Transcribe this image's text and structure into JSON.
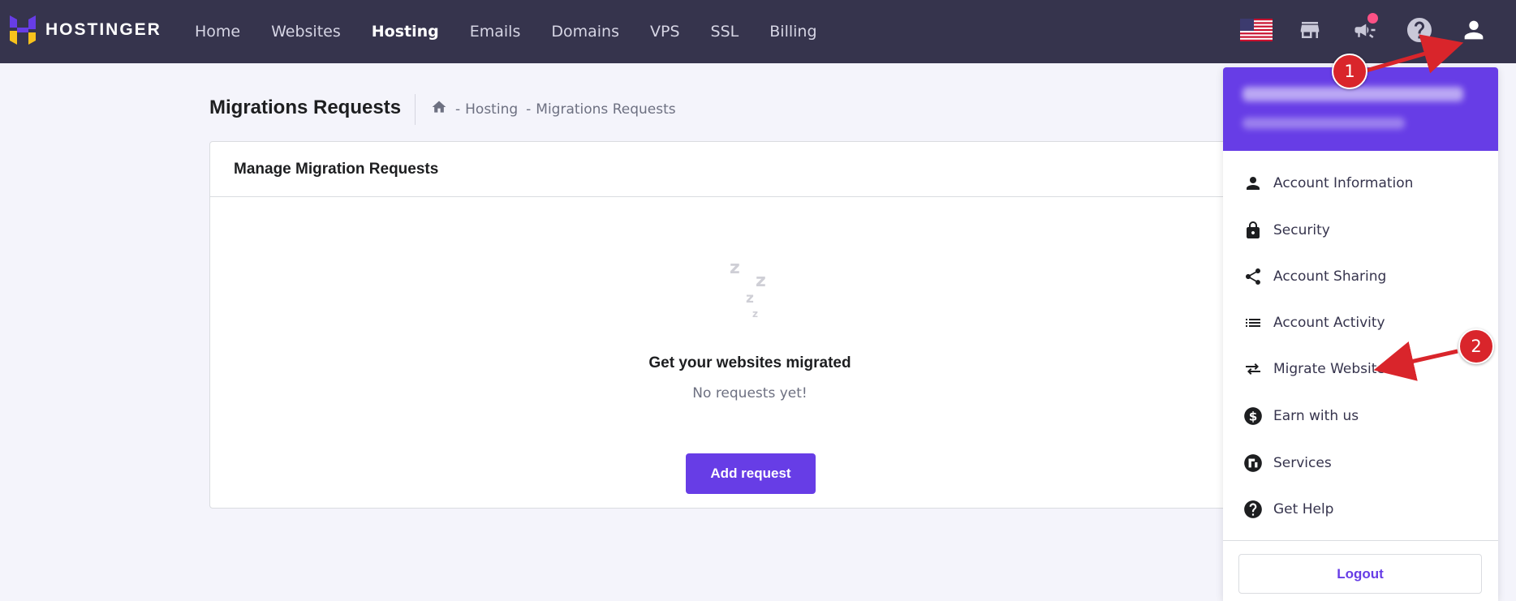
{
  "brand": {
    "name": "HOSTINGER",
    "accent": "#673de6",
    "nav_bg": "#36344d"
  },
  "nav": {
    "items": [
      {
        "label": "Home",
        "active": false
      },
      {
        "label": "Websites",
        "active": false
      },
      {
        "label": "Hosting",
        "active": true
      },
      {
        "label": "Emails",
        "active": false
      },
      {
        "label": "Domains",
        "active": false
      },
      {
        "label": "VPS",
        "active": false
      },
      {
        "label": "SSL",
        "active": false
      },
      {
        "label": "Billing",
        "active": false
      }
    ],
    "right_icons": [
      "us-flag-icon",
      "store-icon",
      "megaphone-icon",
      "help-icon",
      "user-icon"
    ]
  },
  "page": {
    "title": "Migrations Requests",
    "breadcrumb": [
      {
        "label": "Hosting"
      },
      {
        "label": "Migrations Requests"
      }
    ]
  },
  "card": {
    "header": "Manage Migration Requests",
    "empty_title": "Get your websites migrated",
    "empty_subtitle": "No requests yet!",
    "add_button": "Add request"
  },
  "dropdown": {
    "items": [
      {
        "label": "Account Information",
        "icon": "person-icon"
      },
      {
        "label": "Security",
        "icon": "lock-icon"
      },
      {
        "label": "Account Sharing",
        "icon": "share-icon"
      },
      {
        "label": "Account Activity",
        "icon": "list-icon"
      },
      {
        "label": "Migrate Website",
        "icon": "migrate-arrows-icon"
      },
      {
        "label": "Earn with us",
        "icon": "dollar-icon"
      },
      {
        "label": "Services",
        "icon": "services-icon"
      },
      {
        "label": "Get Help",
        "icon": "help-icon"
      }
    ],
    "logout": "Logout"
  },
  "annotations": {
    "marker_1": "1",
    "marker_2": "2",
    "color": "#d9252b"
  }
}
